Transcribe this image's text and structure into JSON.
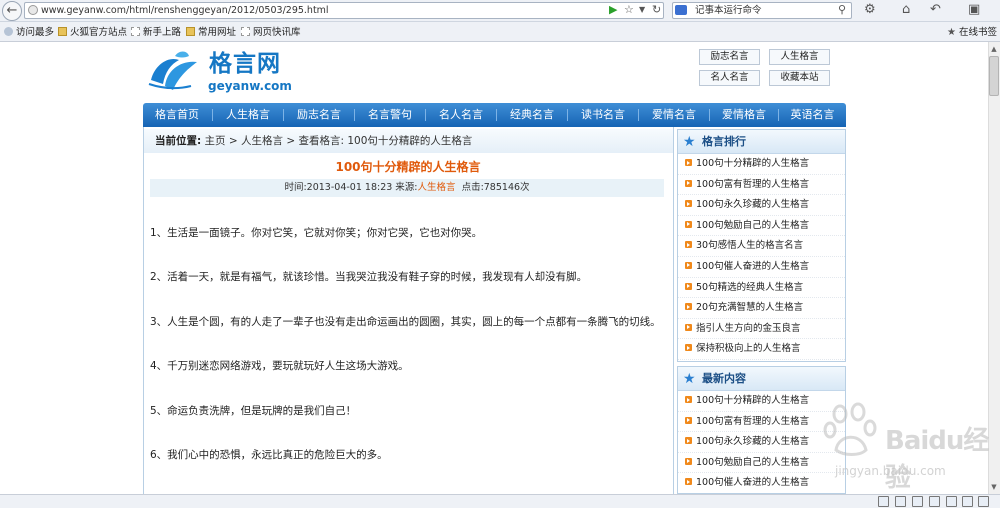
{
  "browser": {
    "url": "www.geyanw.com/html/renshenggeyan/2012/0503/295.html",
    "search_text": "记事本运行命令",
    "bookmarks": [
      "访问最多",
      "火狐官方站点",
      "新手上路",
      "常用网址",
      "网页快讯库"
    ],
    "bookmarks_right": "在线书签"
  },
  "site": {
    "logo_title": "格言网",
    "logo_domain": "geyanw.com",
    "top_links": [
      "励志名言",
      "人生格言",
      "名人名言",
      "收藏本站"
    ],
    "nav": [
      "格言首页",
      "人生格言",
      "励志名言",
      "名言警句",
      "名人名言",
      "经典名言",
      "读书名言",
      "爱情名言",
      "爱情格言",
      "英语名言"
    ]
  },
  "breadcrumb": {
    "label": "当前位置:",
    "path": "主页 > 人生格言 > 查看格言: 100句十分精辟的人生格言"
  },
  "article": {
    "title": "100句十分精辟的人生格言",
    "meta_prefix": "时间:2013-04-01 18:23  来源:",
    "source": "人生格言",
    "meta_suffix": "点击:785146次",
    "paragraphs": [
      "1、生活是一面镜子。你对它笑，它就对你笑；你对它哭，它也对你哭。",
      "2、活着一天，就是有福气，就该珍惜。当我哭泣我没有鞋子穿的时候，我发现有人却没有脚。",
      "3、人生是个圆，有的人走了一辈子也没有走出命运画出的圆圈，其实，圆上的每一个点都有一条腾飞的切线。",
      "4、千万别迷恋网络游戏，要玩就玩好人生这场大游戏。",
      "5、命运负责洗牌，但是玩牌的是我们自己！",
      "6、我们心中的恐惧，永远比真正的危险巨大的多。"
    ]
  },
  "sidebar": {
    "ranking": {
      "title": "格言排行",
      "items": [
        "100句十分精辟的人生格言",
        "100句富有哲理的人生格言",
        "100句永久珍藏的人生格言",
        "100句勉励自己的人生格言",
        "30句感悟人生的格言名言",
        "100句催人奋进的人生格言",
        "50句精选的经典人生格言",
        "20句充满智慧的人生格言",
        "指引人生方向的金玉良言",
        "保持积极向上的人生格言"
      ]
    },
    "latest": {
      "title": "最新内容",
      "items": [
        "100句十分精辟的人生格言",
        "100句富有哲理的人生格言",
        "100句永久珍藏的人生格言",
        "100句勉励自己的人生格言",
        "100句催人奋进的人生格言"
      ]
    }
  },
  "watermark": {
    "text": "Baidu经验",
    "url": "jingyan.baidu.com"
  },
  "colors": {
    "nav_blue": "#1f72c2",
    "accent_orange": "#e05a0c",
    "logo_blue": "#1577c4"
  }
}
